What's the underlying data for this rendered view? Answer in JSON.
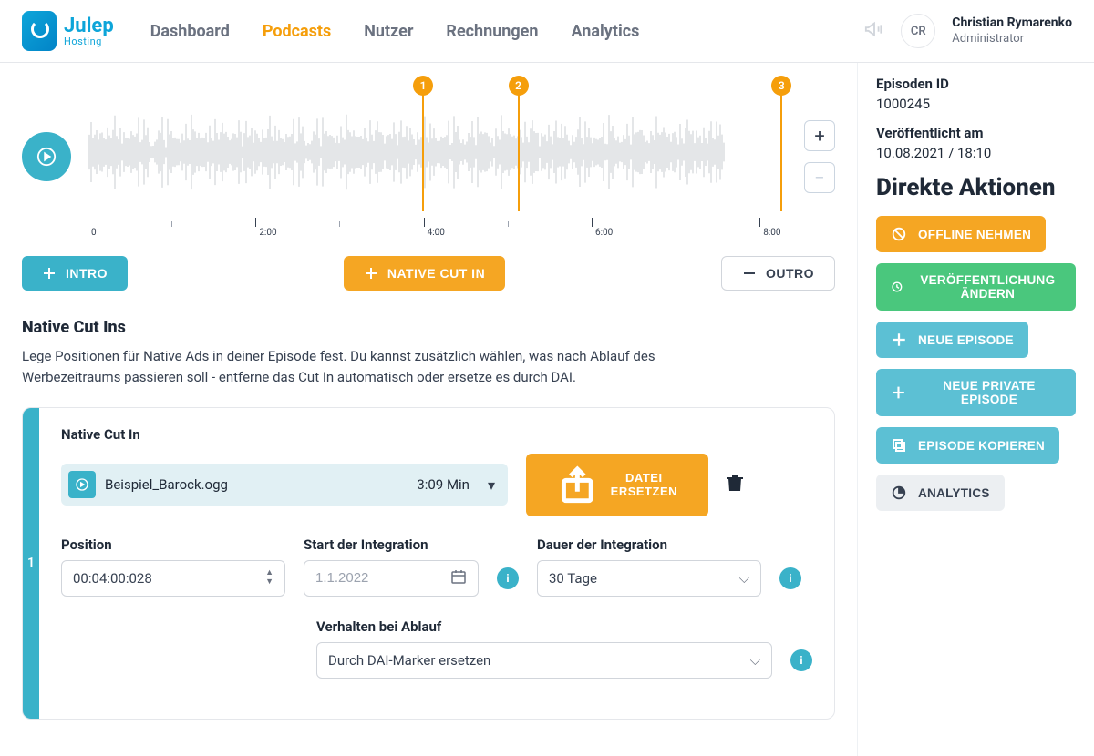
{
  "brand": {
    "title": "Julep",
    "sub": "Hosting"
  },
  "nav": {
    "items": [
      "Dashboard",
      "Podcasts",
      "Nutzer",
      "Rechnungen",
      "Analytics"
    ],
    "active_index": 1
  },
  "user": {
    "initials": "CR",
    "name": "Christian Rymarenko",
    "role": "Administrator"
  },
  "wave": {
    "markers": [
      {
        "num": "1",
        "pct": 47.8
      },
      {
        "num": "2",
        "pct": 61.4
      },
      {
        "num": "3",
        "pct": 99.0
      }
    ],
    "ticks": [
      {
        "label": "0",
        "pct": 0,
        "major": true
      },
      {
        "pct": 12,
        "major": false
      },
      {
        "label": "2:00",
        "pct": 24,
        "major": true
      },
      {
        "pct": 36,
        "major": false
      },
      {
        "label": "4:00",
        "pct": 48,
        "major": true
      },
      {
        "pct": 60,
        "major": false
      },
      {
        "label": "6:00",
        "pct": 72,
        "major": true
      },
      {
        "pct": 84,
        "major": false
      },
      {
        "label": "8:00",
        "pct": 96,
        "major": true
      }
    ]
  },
  "buttons": {
    "intro": "INTRO",
    "native": "NATIVE CUT IN",
    "outro": "OUTRO"
  },
  "section": {
    "title": "Native Cut Ins",
    "desc": "Lege Positionen für Native Ads in deiner Episode fest. Du kannst zusätzlich wählen, was nach Ablauf des Werbezeitraums passieren soll - entferne das Cut In automatisch oder ersetze es durch DAI."
  },
  "cutin": {
    "index": "1",
    "label": "Native Cut In",
    "file_name": "Beispiel_Barock.ogg",
    "file_duration": "3:09 Min",
    "replace": "DATEI ERSETZEN",
    "pos_label": "Position",
    "pos_value": "00:04:00:028",
    "start_label": "Start der Integration",
    "start_placeholder": "1.1.2022",
    "dur_label": "Dauer der Integration",
    "dur_value": "30 Tage",
    "expire_label": "Verhalten bei Ablauf",
    "expire_value": "Durch DAI-Marker ersetzen"
  },
  "sidebar": {
    "ep_id_label": "Episoden ID",
    "ep_id": "1000245",
    "pub_label": "Veröffentlicht am",
    "pub_value": "10.08.2021 / 18:10",
    "actions_title": "Direkte Aktionen",
    "actions": {
      "offline": "OFFLINE NEHMEN",
      "change_pub": "VERÖFFENTLICHUNG ÄNDERN",
      "new_ep": "NEUE EPISODE",
      "new_priv": "NEUE PRIVATE EPISODE",
      "copy": "EPISODE KOPIEREN",
      "analytics": "ANALYTICS"
    }
  }
}
